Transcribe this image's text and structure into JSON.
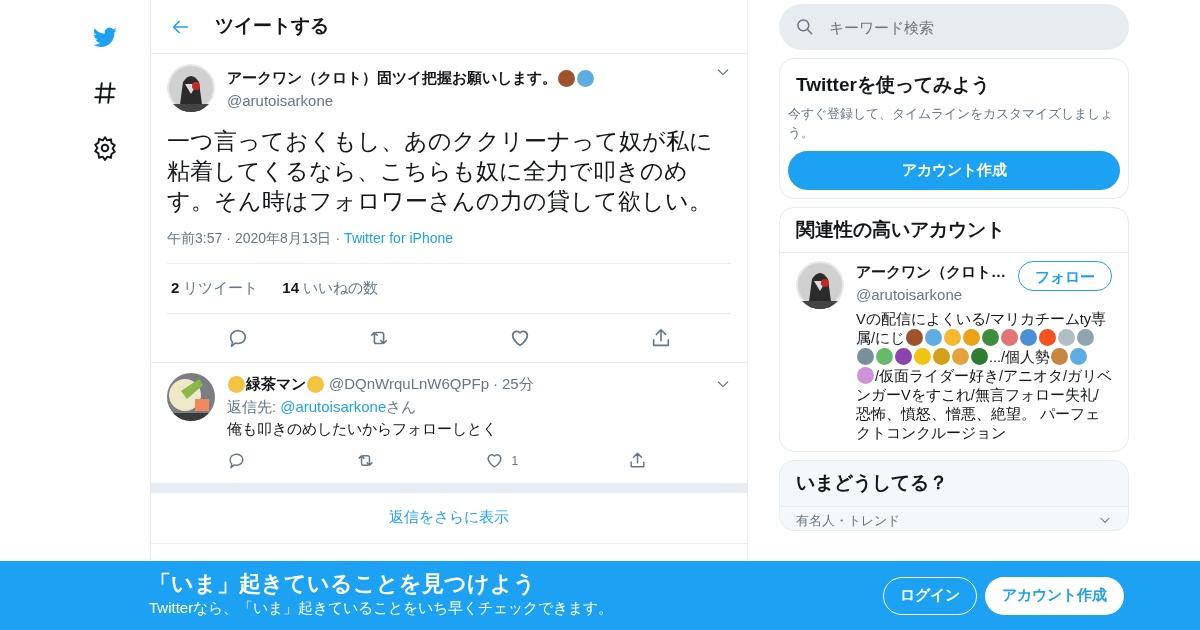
{
  "nav": {
    "items": [
      {
        "kind": "logo"
      },
      {
        "kind": "hash"
      },
      {
        "kind": "settings"
      }
    ]
  },
  "header": {
    "title": "ツイートする"
  },
  "tweet": {
    "name": "アークワン（クロト）固ツイ把握お願いします。",
    "name_emojis": [
      {
        "color": "#a0522d"
      },
      {
        "color": "#5dade2"
      }
    ],
    "handle": "@arutoisarkone",
    "text": "一つ言っておくもし、あのククリーナって奴が私に粘着してくるなら、こちらも奴に全力で叩きのめす。そん時はフォロワーさんの力の貸して欲しい。",
    "time": "午前3:57",
    "separator": "·",
    "date": "2020年8月13日",
    "source": "Twitter for iPhone",
    "stats": [
      {
        "count": "2",
        "label": "リツイート"
      },
      {
        "count": "14",
        "label": "いいねの数"
      }
    ]
  },
  "reply": {
    "name": "緑茶マン",
    "handle": "@DQnWrquLnW6QPFp",
    "separator": "·",
    "age": "25分",
    "reply_to_label": "返信先:",
    "reply_to": "@arutoisarkone",
    "reply_to_suffix": "さん",
    "text": "俺も叩きのめしたいからフォローしとく",
    "likes": "1"
  },
  "more_replies": "返信をさらに表示",
  "search": {
    "placeholder": "キーワード検索"
  },
  "signup_card": {
    "title": "Twitterを使ってみよう",
    "text": "今すぐ登録して、タイムラインをカスタマイズしましょう。",
    "button": "アカウント作成"
  },
  "related": {
    "title": "関連性の高いアカウント",
    "name": "アークワン（クロト…",
    "handle": "@arutoisarkone",
    "follow": "フォロー",
    "bio_lines": [
      [
        {
          "kind": "text",
          "text": "Vの配信によくいる/マリカチームty専"
        }
      ],
      [
        {
          "kind": "text",
          "text": "属/にじ"
        },
        {
          "kind": "emoji",
          "color": "#a0522d"
        },
        {
          "kind": "emoji",
          "color": "#5dade2"
        },
        {
          "kind": "emoji",
          "color": "#f5b82e"
        },
        {
          "kind": "emoji",
          "color": "#e8a317"
        },
        {
          "kind": "emoji",
          "color": "#3e8e3e"
        },
        {
          "kind": "emoji",
          "color": "#e57373"
        },
        {
          "kind": "emoji",
          "color": "#4a90d9"
        },
        {
          "kind": "emoji",
          "color": "#f4511e"
        },
        {
          "kind": "emoji",
          "color": "#b0bec5"
        },
        {
          "kind": "emoji",
          "color": "#90a4ae"
        }
      ],
      [
        {
          "kind": "emoji",
          "color": "#78909c"
        },
        {
          "kind": "emoji",
          "color": "#66bb6a"
        },
        {
          "kind": "emoji",
          "color": "#8e44ad"
        },
        {
          "kind": "emoji",
          "color": "#f1c40f"
        },
        {
          "kind": "emoji",
          "color": "#d4a017"
        },
        {
          "kind": "emoji",
          "color": "#e6a23c"
        },
        {
          "kind": "emoji",
          "color": "#2e7d32"
        },
        {
          "kind": "text",
          "text": ".../個人勢"
        },
        {
          "kind": "emoji",
          "color": "#c68642"
        },
        {
          "kind": "emoji",
          "color": "#5dade2"
        }
      ],
      [
        {
          "kind": "emoji",
          "color": "#ce93d8"
        },
        {
          "kind": "text",
          "text": "/仮面ライダー好き/アニオタ/ガリベ"
        }
      ],
      [
        {
          "kind": "text",
          "text": "ンガーVをすこれ/無言フォロー失礼/"
        }
      ],
      [
        {
          "kind": "text",
          "text": "恐怖、憤怒、憎悪、絶望。 パーフェ"
        }
      ],
      [
        {
          "kind": "text",
          "text": "クトコンクルージョン"
        }
      ]
    ]
  },
  "trends": {
    "title": "いまどうしてる？",
    "first": "有名人・トレンド"
  },
  "banner": {
    "title": "「いま」起きていることを見つけよう",
    "text": "Twitterなら、「いま」起きていることをいち早くチェックできます。",
    "login": "ログイン",
    "signup": "アカウント作成"
  }
}
